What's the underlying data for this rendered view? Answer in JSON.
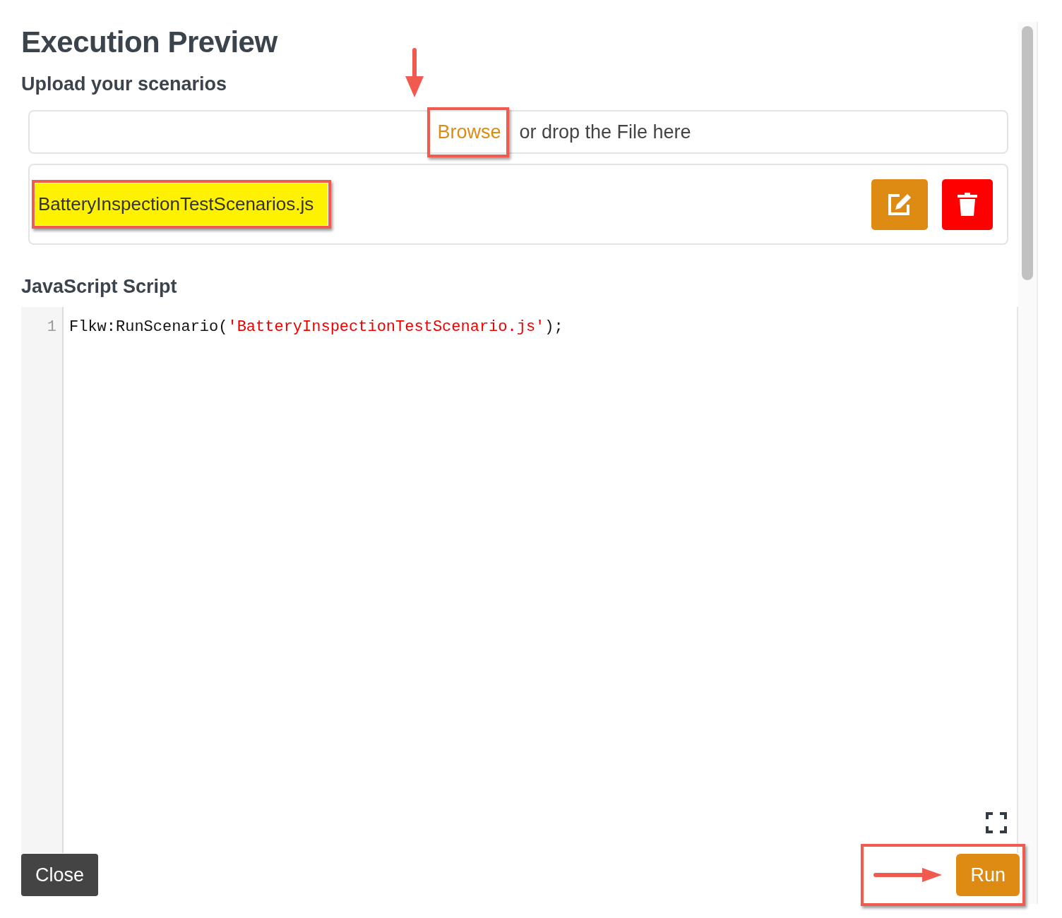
{
  "title": "Execution Preview",
  "upload": {
    "heading": "Upload your scenarios",
    "browse_link": "Browse",
    "drop_text": "or drop the File here"
  },
  "file": {
    "name": "BatteryInspectionTestScenarios.js",
    "highlighted": true
  },
  "editor": {
    "heading": "JavaScript Script",
    "lines": [
      {
        "number": "1",
        "tokens": [
          {
            "kind": "plain",
            "text": "Flkw:RunScenario("
          },
          {
            "kind": "string",
            "text": "'BatteryInspectionTestScenario.js'"
          },
          {
            "kind": "plain",
            "text": ");"
          }
        ]
      }
    ]
  },
  "buttons": {
    "close": "Close",
    "run": "Run"
  }
}
